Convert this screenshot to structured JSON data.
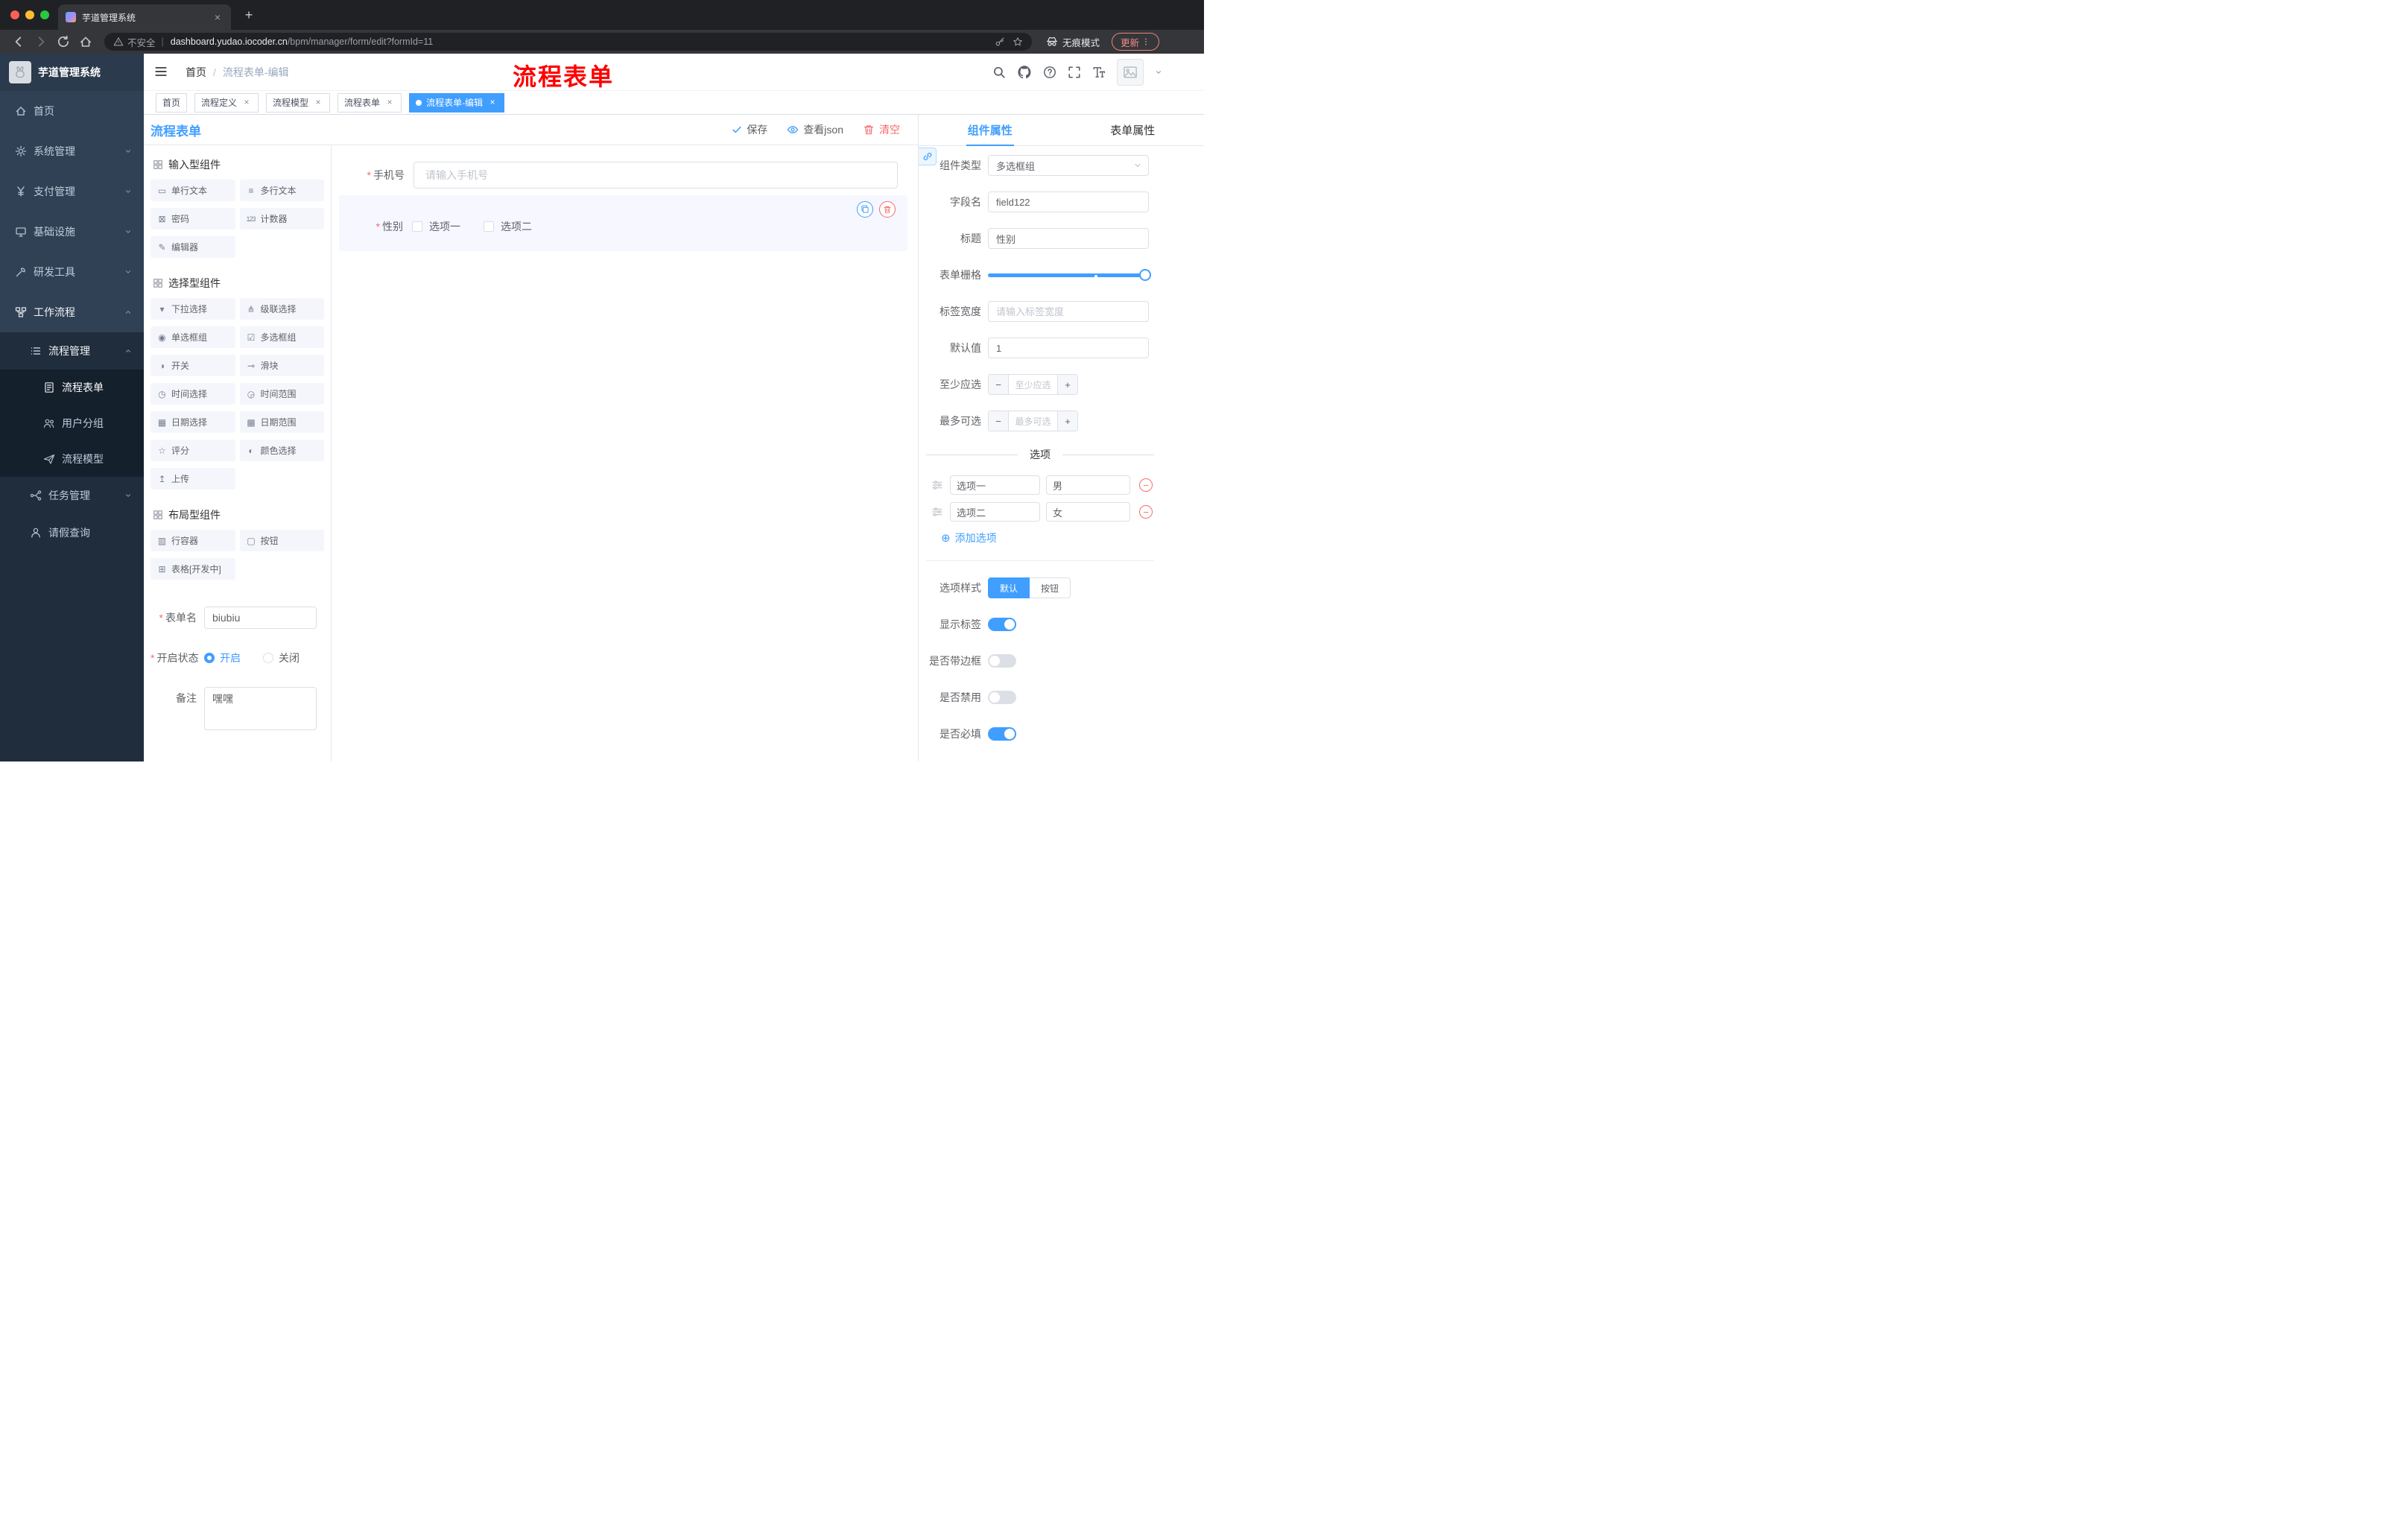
{
  "glyphs": {
    "asterisk": "*",
    "close": "×",
    "plus": "+",
    "minus": "−",
    "circle_plus": "⊕",
    "pipe": "|"
  },
  "browser": {
    "tab_title": "芋道管理系统",
    "security_label": "不安全",
    "url_domain": "dashboard.yudao.iocoder.cn",
    "url_path": "/bpm/manager/form/edit?formId=11",
    "incognito_label": "无痕模式",
    "update_label": "更新"
  },
  "sidebar": {
    "app_title": "芋道管理系统",
    "items": [
      {
        "label": "首页"
      },
      {
        "label": "系统管理"
      },
      {
        "label": "支付管理"
      },
      {
        "label": "基础设施"
      },
      {
        "label": "研发工具"
      },
      {
        "label": "工作流程"
      },
      {
        "label": "流程管理"
      },
      {
        "label": "流程表单"
      },
      {
        "label": "用户分组"
      },
      {
        "label": "流程模型"
      },
      {
        "label": "任务管理"
      },
      {
        "label": "请假查询"
      }
    ]
  },
  "header": {
    "breadcrumb": {
      "home": "首页",
      "sep": "/",
      "current": "流程表单-编辑"
    },
    "annotation": "流程表单"
  },
  "tags": [
    {
      "label": "首页"
    },
    {
      "label": "流程定义"
    },
    {
      "label": "流程模型"
    },
    {
      "label": "流程表单"
    },
    {
      "label": "流程表单-编辑"
    }
  ],
  "toolbar": {
    "title": "流程表单",
    "save": "保存",
    "view_json": "查看json",
    "clear": "清空"
  },
  "palette": {
    "sections": {
      "input": {
        "title": "输入型组件",
        "items": [
          {
            "label": "单行文本",
            "glyph": "▭"
          },
          {
            "label": "多行文本",
            "glyph": "≡"
          },
          {
            "label": "密码",
            "glyph": "⊠"
          },
          {
            "label": "计数器",
            "glyph": "123"
          },
          {
            "label": "编辑器",
            "glyph": "✎"
          }
        ]
      },
      "select": {
        "title": "选择型组件",
        "items": [
          {
            "label": "下拉选择",
            "glyph": "▾"
          },
          {
            "label": "级联选择",
            "glyph": "⋔"
          },
          {
            "label": "单选框组",
            "glyph": "◉"
          },
          {
            "label": "多选框组",
            "glyph": "☑"
          },
          {
            "label": "开关",
            "glyph": "◑"
          },
          {
            "label": "滑块",
            "glyph": "⊸"
          },
          {
            "label": "时间选择",
            "glyph": "◷"
          },
          {
            "label": "时间范围",
            "glyph": "◶"
          },
          {
            "label": "日期选择",
            "glyph": "▦"
          },
          {
            "label": "日期范围",
            "glyph": "▩"
          },
          {
            "label": "评分",
            "glyph": "☆"
          },
          {
            "label": "颜色选择",
            "glyph": "◐"
          },
          {
            "label": "上传",
            "glyph": "↥"
          }
        ]
      },
      "layout": {
        "title": "布局型组件",
        "items": [
          {
            "label": "行容器",
            "glyph": "▥"
          },
          {
            "label": "按钮",
            "glyph": "▢"
          },
          {
            "label": "表格[开发中]",
            "glyph": "⊞"
          }
        ]
      }
    },
    "form": {
      "name_label": "表单名",
      "name_value": "biubiu",
      "status_label": "开启状态",
      "status_on": "开启",
      "status_off": "关闭",
      "remark_label": "备注",
      "remark_value": "嘿嘿"
    }
  },
  "canvas": {
    "phone": {
      "label": "手机号",
      "placeholder": "请输入手机号"
    },
    "gender": {
      "label": "性别",
      "options": [
        {
          "label": "选项一"
        },
        {
          "label": "选项二"
        }
      ]
    }
  },
  "props": {
    "tab_component": "组件属性",
    "tab_form": "表单属性",
    "component_type_label": "组件类型",
    "component_type_value": "多选框组",
    "field_name_label": "字段名",
    "field_name_value": "field122",
    "title_label": "标题",
    "title_value": "性别",
    "grid_label": "表单栅格",
    "label_width_label": "标签宽度",
    "label_width_placeholder": "请输入标签宽度",
    "default_label": "默认值",
    "default_value": "1",
    "min_label": "至少应选",
    "min_placeholder": "至少应选",
    "max_label": "最多可选",
    "max_placeholder": "最多可选",
    "options_divider": "选项",
    "options": [
      {
        "label": "选项一",
        "value": "男"
      },
      {
        "label": "选项二",
        "value": "女"
      }
    ],
    "add_option": "添加选项",
    "style_label": "选项样式",
    "style_default": "默认",
    "style_button": "按钮",
    "toggle_show_label": "显示标签",
    "toggle_border": "是否带边框",
    "toggle_disabled": "是否禁用",
    "toggle_required": "是否必填"
  }
}
